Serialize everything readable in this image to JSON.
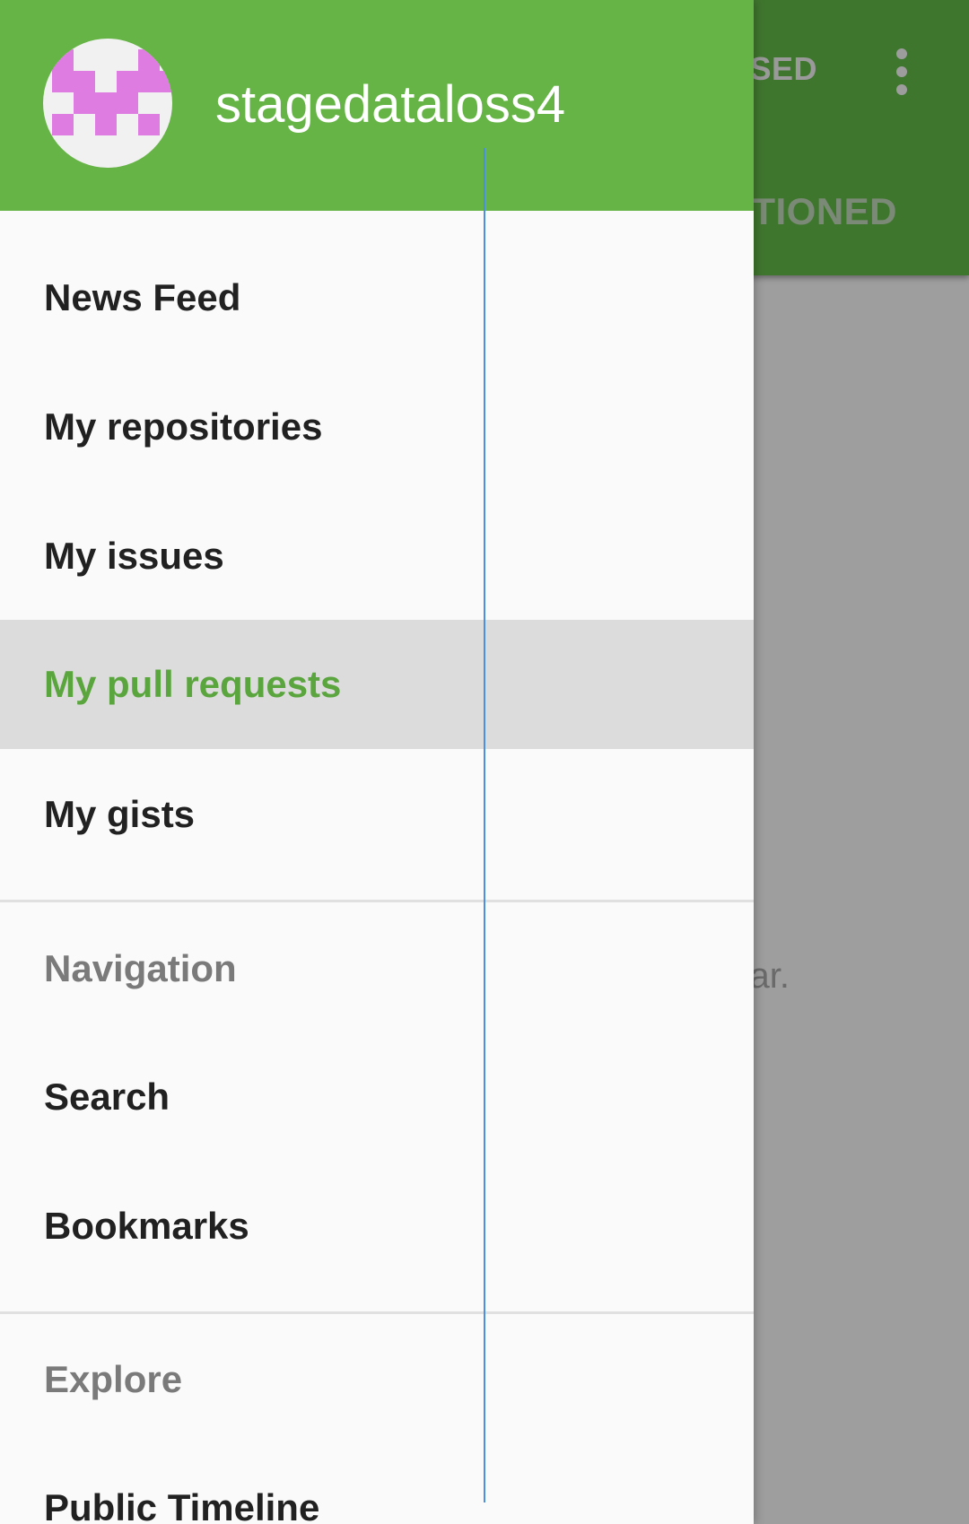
{
  "background": {
    "tab_closed_label": "OSED",
    "tab_mentioned_label": "NTIONED",
    "empty_text": "ar.",
    "overflow_icon": "more-vert-icon"
  },
  "drawer": {
    "username": "stagedataloss4",
    "avatar_icon": "identicon-avatar",
    "accent_color": "#66b446",
    "items": [
      {
        "label": "News Feed"
      },
      {
        "label": "My repositories"
      },
      {
        "label": "My issues"
      },
      {
        "label": "My pull requests",
        "selected": true
      },
      {
        "label": "My gists"
      }
    ],
    "navigation": {
      "header": "Navigation",
      "items": [
        {
          "label": "Search"
        },
        {
          "label": "Bookmarks"
        }
      ]
    },
    "explore": {
      "header": "Explore",
      "items": [
        {
          "label": "Public Timeline"
        }
      ]
    }
  }
}
